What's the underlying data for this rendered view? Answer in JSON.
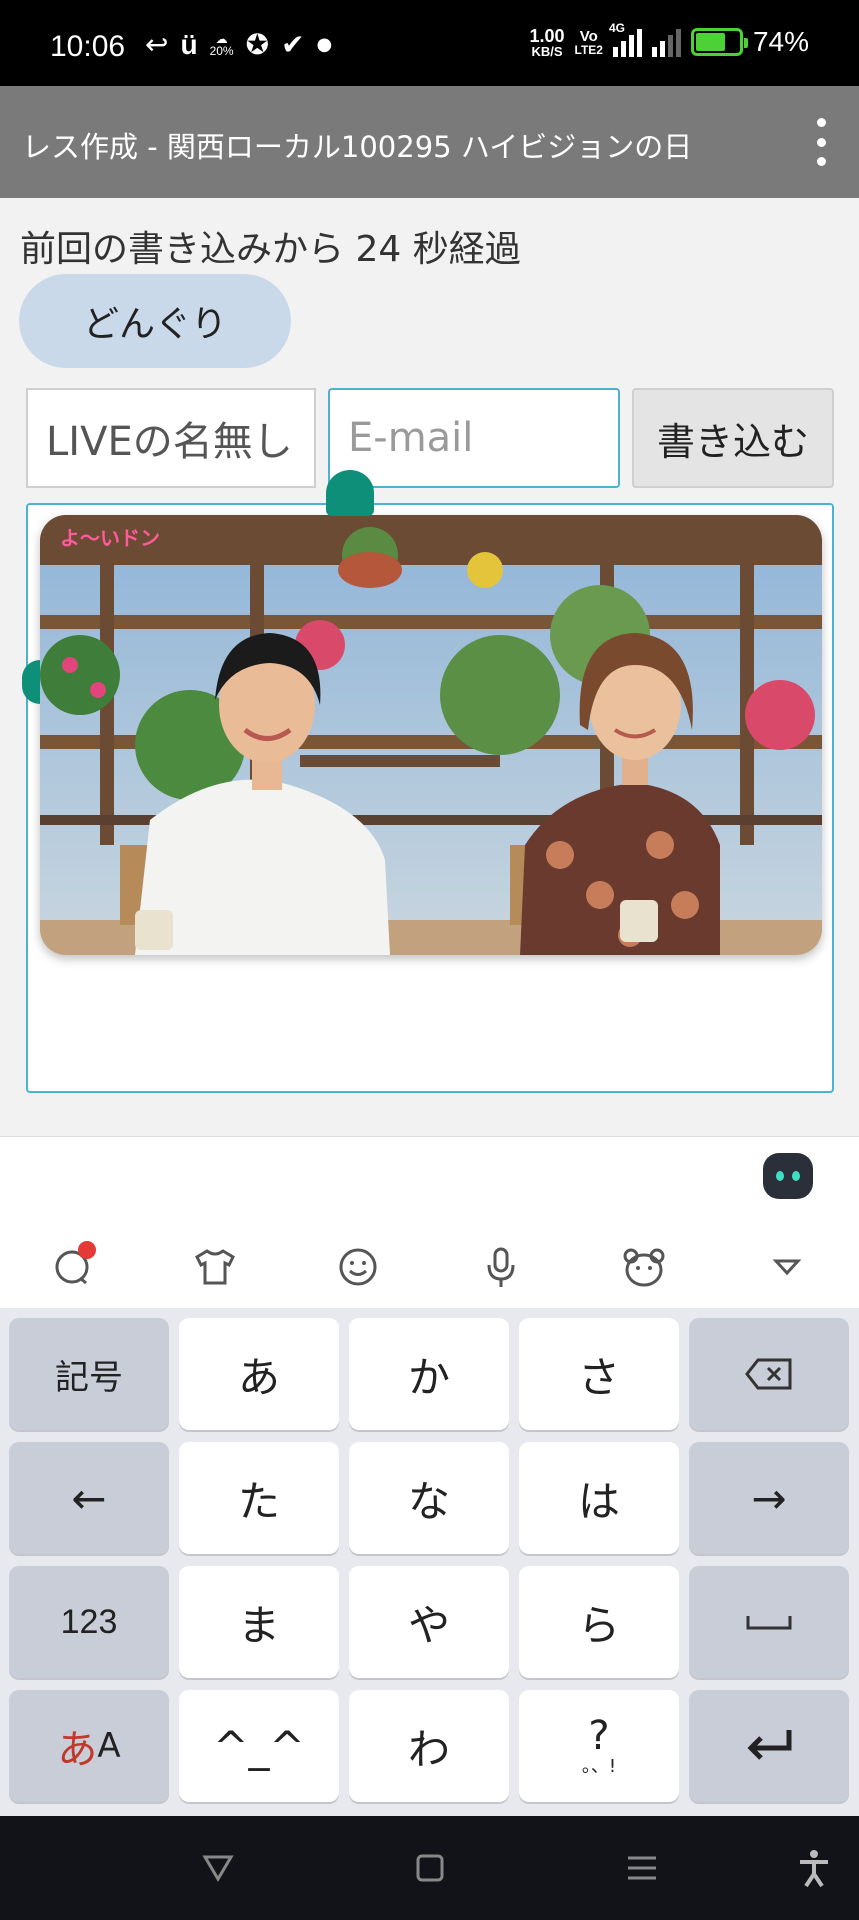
{
  "status_bar": {
    "time": "10:06",
    "speed_value": "1.00",
    "speed_unit": "KB/S",
    "volte_top": "Vo",
    "volte_bottom": "LTE2",
    "network": "4G",
    "battery": "74%",
    "battery_level": 0.74,
    "percent_small": "20%"
  },
  "app_bar": {
    "title": "レス作成 - 関西ローカル100295 ハイビジョンの日"
  },
  "form": {
    "elapsed_text": "前回の書き込みから 24 秒経過",
    "dongri_label": "どんぐり",
    "name_value": "LIVEの名無し",
    "email_placeholder": "E-mail",
    "submit_label": "書き込む"
  },
  "keyboard": {
    "row1": [
      "記号",
      "あ",
      "か",
      "さ",
      "⌫"
    ],
    "row2": [
      "←",
      "た",
      "な",
      "は",
      "→"
    ],
    "row3": [
      "123",
      "ま",
      "や",
      "ら",
      "␣"
    ],
    "row4": [
      "あA",
      "^_^",
      "わ",
      "?。、!",
      "↵"
    ],
    "mode_a": "あ",
    "mode_b": "A",
    "punct_main": "?",
    "punct_sub": "。、!"
  },
  "colors": {
    "accent": "#4ab3d1",
    "handle": "#0e8f7a",
    "app_bar": "#7a7a7a",
    "dongri_bg": "#c9d9ea"
  }
}
